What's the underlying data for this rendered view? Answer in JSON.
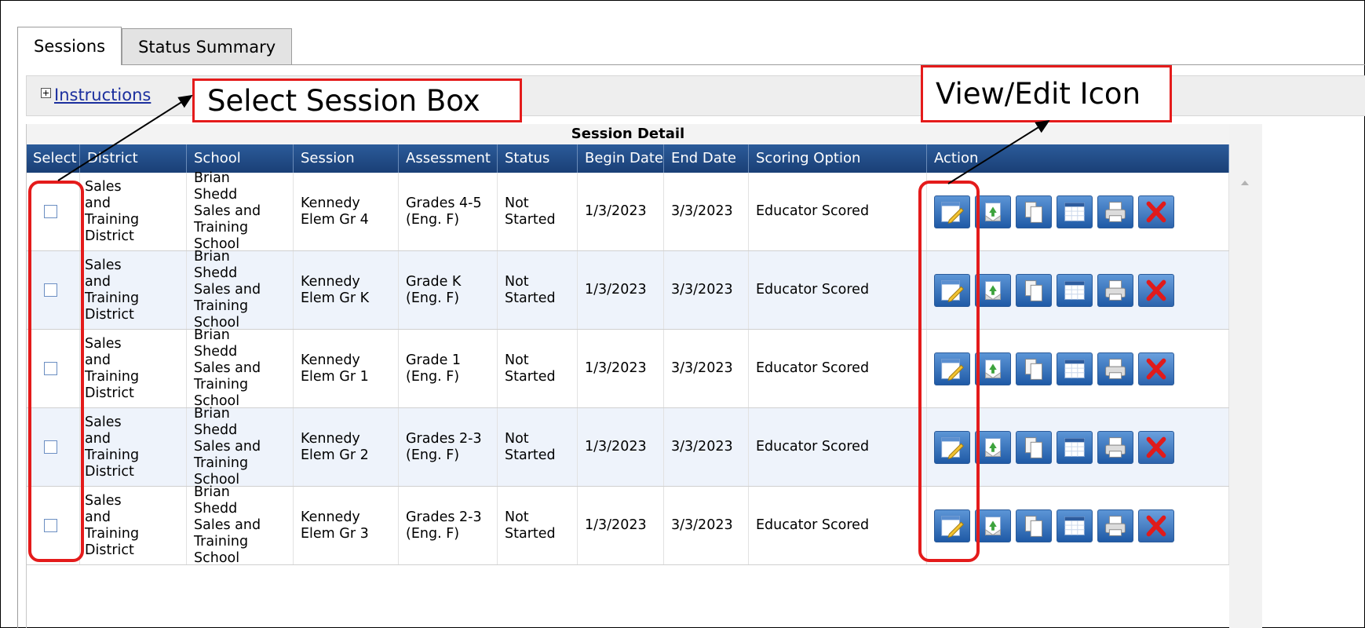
{
  "tabs": [
    {
      "label": "Sessions",
      "active": true
    },
    {
      "label": "Status Summary",
      "active": false
    }
  ],
  "instructions": {
    "label": "Instructions"
  },
  "callouts": {
    "select_session": "Select Session Box",
    "view_edit": "View/Edit Icon"
  },
  "grid": {
    "title": "Session Detail",
    "columns": [
      "Select",
      "District",
      "School",
      "Session Name",
      "Assessment",
      "Status",
      "Begin Date",
      "End Date",
      "Scoring Option",
      "Action"
    ],
    "rows": [
      {
        "district": "Sales and Training District",
        "school": "Brian Shedd Sales and Training School",
        "session_name": "Kennedy Elem Gr 4",
        "assessment": "Grades 4-5 (Eng. F)",
        "status": "Not Started",
        "begin": "1/3/2023",
        "end": "3/3/2023",
        "scoring": "Educator Scored"
      },
      {
        "district": "Sales and Training District",
        "school": "Brian Shedd Sales and Training School",
        "session_name": "Kennedy Elem Gr K",
        "assessment": "Grade K (Eng. F)",
        "status": "Not Started",
        "begin": "1/3/2023",
        "end": "3/3/2023",
        "scoring": "Educator Scored"
      },
      {
        "district": "Sales and Training District",
        "school": "Brian Shedd Sales and Training School",
        "session_name": "Kennedy Elem Gr 1",
        "assessment": "Grade 1 (Eng. F)",
        "status": "Not Started",
        "begin": "1/3/2023",
        "end": "3/3/2023",
        "scoring": "Educator Scored"
      },
      {
        "district": "Sales and Training District",
        "school": "Brian Shedd Sales and Training School",
        "session_name": "Kennedy Elem Gr 2",
        "assessment": "Grades 2-3 (Eng. F)",
        "status": "Not Started",
        "begin": "1/3/2023",
        "end": "3/3/2023",
        "scoring": "Educator Scored"
      },
      {
        "district": "Sales and Training District",
        "school": "Brian Shedd Sales and Training School",
        "session_name": "Kennedy Elem Gr 3",
        "assessment": "Grades 2-3 (Eng. F)",
        "status": "Not Started",
        "begin": "1/3/2023",
        "end": "3/3/2023",
        "scoring": "Educator Scored"
      }
    ],
    "action_icons": [
      "edit-icon",
      "export-icon",
      "copy-icon",
      "table-icon",
      "print-icon",
      "delete-icon"
    ]
  },
  "colors": {
    "header": "#1f4b86",
    "annotation_red": "#e41b1b",
    "row_alt": "#eef3fb",
    "delete_x": "#e01b1b"
  }
}
